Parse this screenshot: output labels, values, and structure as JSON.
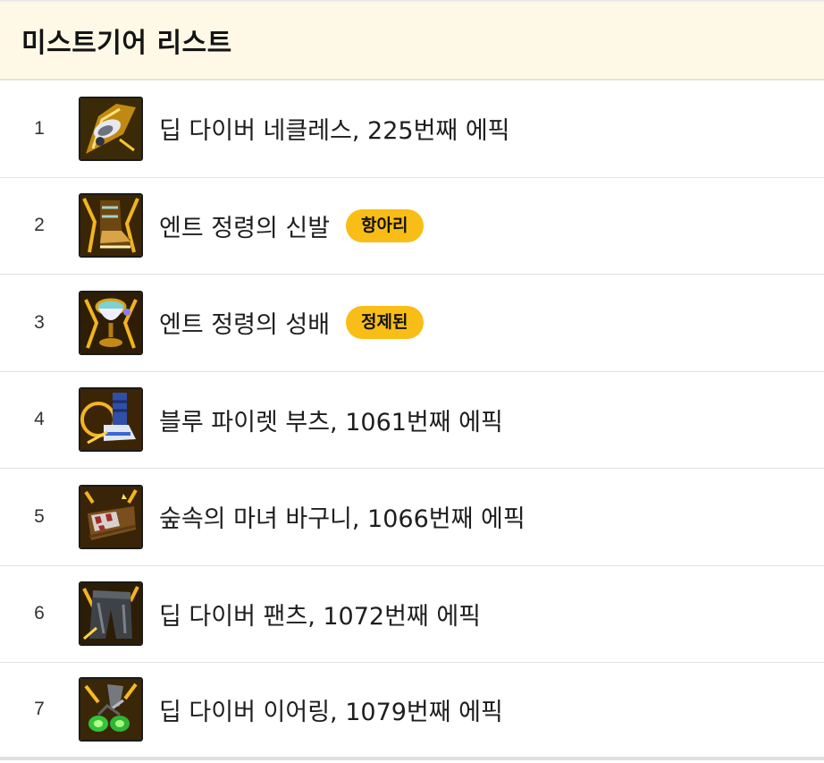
{
  "header": {
    "title": "미스트기어 리스트"
  },
  "items": [
    {
      "rank": "1",
      "name": "딥 다이버 네클레스, 225번째 에픽",
      "badge": null,
      "icon": "necklace-icon"
    },
    {
      "rank": "2",
      "name": "엔트 정령의 신발",
      "badge": "항아리",
      "icon": "boots-icon"
    },
    {
      "rank": "3",
      "name": "엔트 정령의 성배",
      "badge": "정제된",
      "icon": "chalice-icon"
    },
    {
      "rank": "4",
      "name": "블루 파이렛 부츠, 1061번째 에픽",
      "badge": null,
      "icon": "pirate-boots-icon"
    },
    {
      "rank": "5",
      "name": "숲속의 마녀 바구니, 1066번째 에픽",
      "badge": null,
      "icon": "basket-icon"
    },
    {
      "rank": "6",
      "name": "딥 다이버 팬츠, 1072번째 에픽",
      "badge": null,
      "icon": "pants-icon"
    },
    {
      "rank": "7",
      "name": "딥 다이버 이어링, 1079번째 에픽",
      "badge": null,
      "icon": "earring-icon"
    }
  ],
  "colors": {
    "header_bg": "#fef9e6",
    "badge_bg": "#f8bd16",
    "divider": "#e2e2e2",
    "icon_gold": "#d9a21a"
  }
}
